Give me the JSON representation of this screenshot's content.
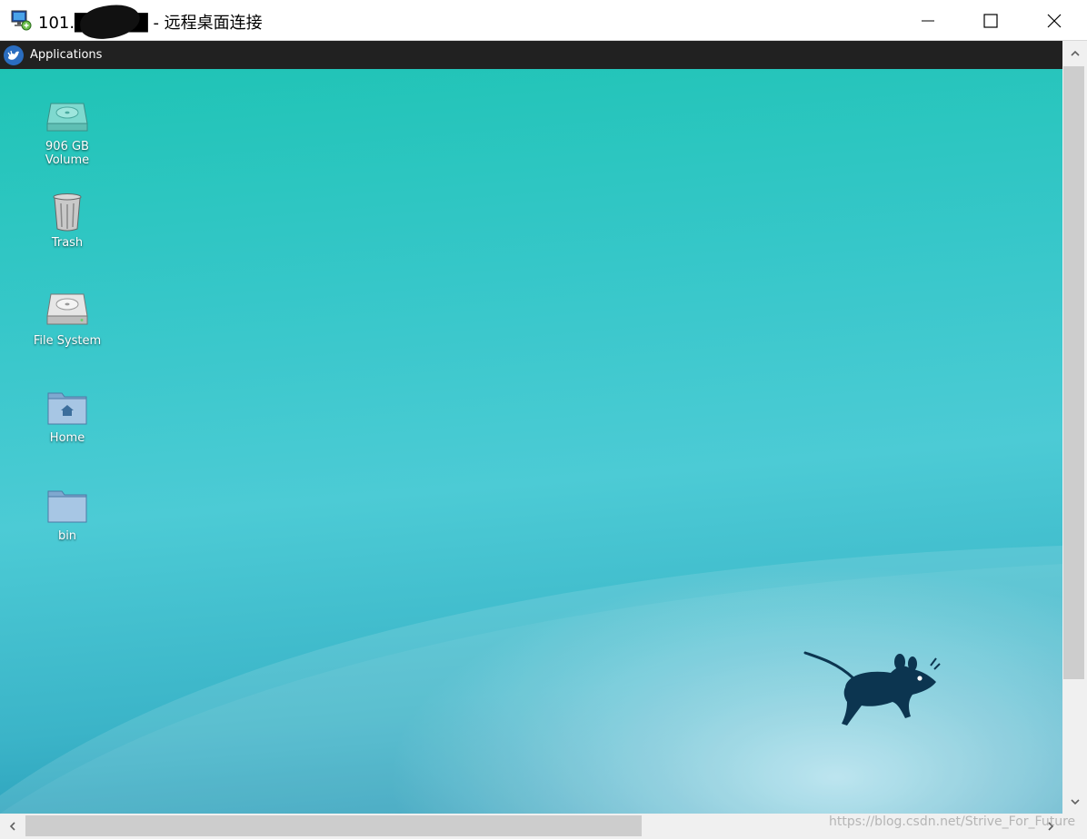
{
  "window": {
    "title": "101.█.██.██ - 远程桌面连接",
    "icons": {
      "app": "remote-desktop-icon",
      "minimize": "minimize-icon",
      "maximize": "maximize-icon",
      "close": "close-icon"
    }
  },
  "panel": {
    "applications_label": "Applications",
    "logo": "xfce-logo-icon"
  },
  "desktop": {
    "icons": [
      {
        "label_line1": "906 GB",
        "label_line2": "Volume",
        "icon": "hard-drive-icon"
      },
      {
        "label_line1": "Trash",
        "icon": "trash-icon"
      },
      {
        "label_line1": "File System",
        "icon": "hard-drive-icon"
      },
      {
        "label_line1": "Home",
        "icon": "home-folder-icon"
      },
      {
        "label_line1": "bin",
        "icon": "folder-icon"
      }
    ],
    "wallpaper_logo": "xfce-mouse-icon",
    "colors": {
      "top": "#1fc4b5",
      "bottom": "#2293b3",
      "mouse": "#0c3550"
    }
  },
  "watermark": "https://blog.csdn.net/Strive_For_Future"
}
